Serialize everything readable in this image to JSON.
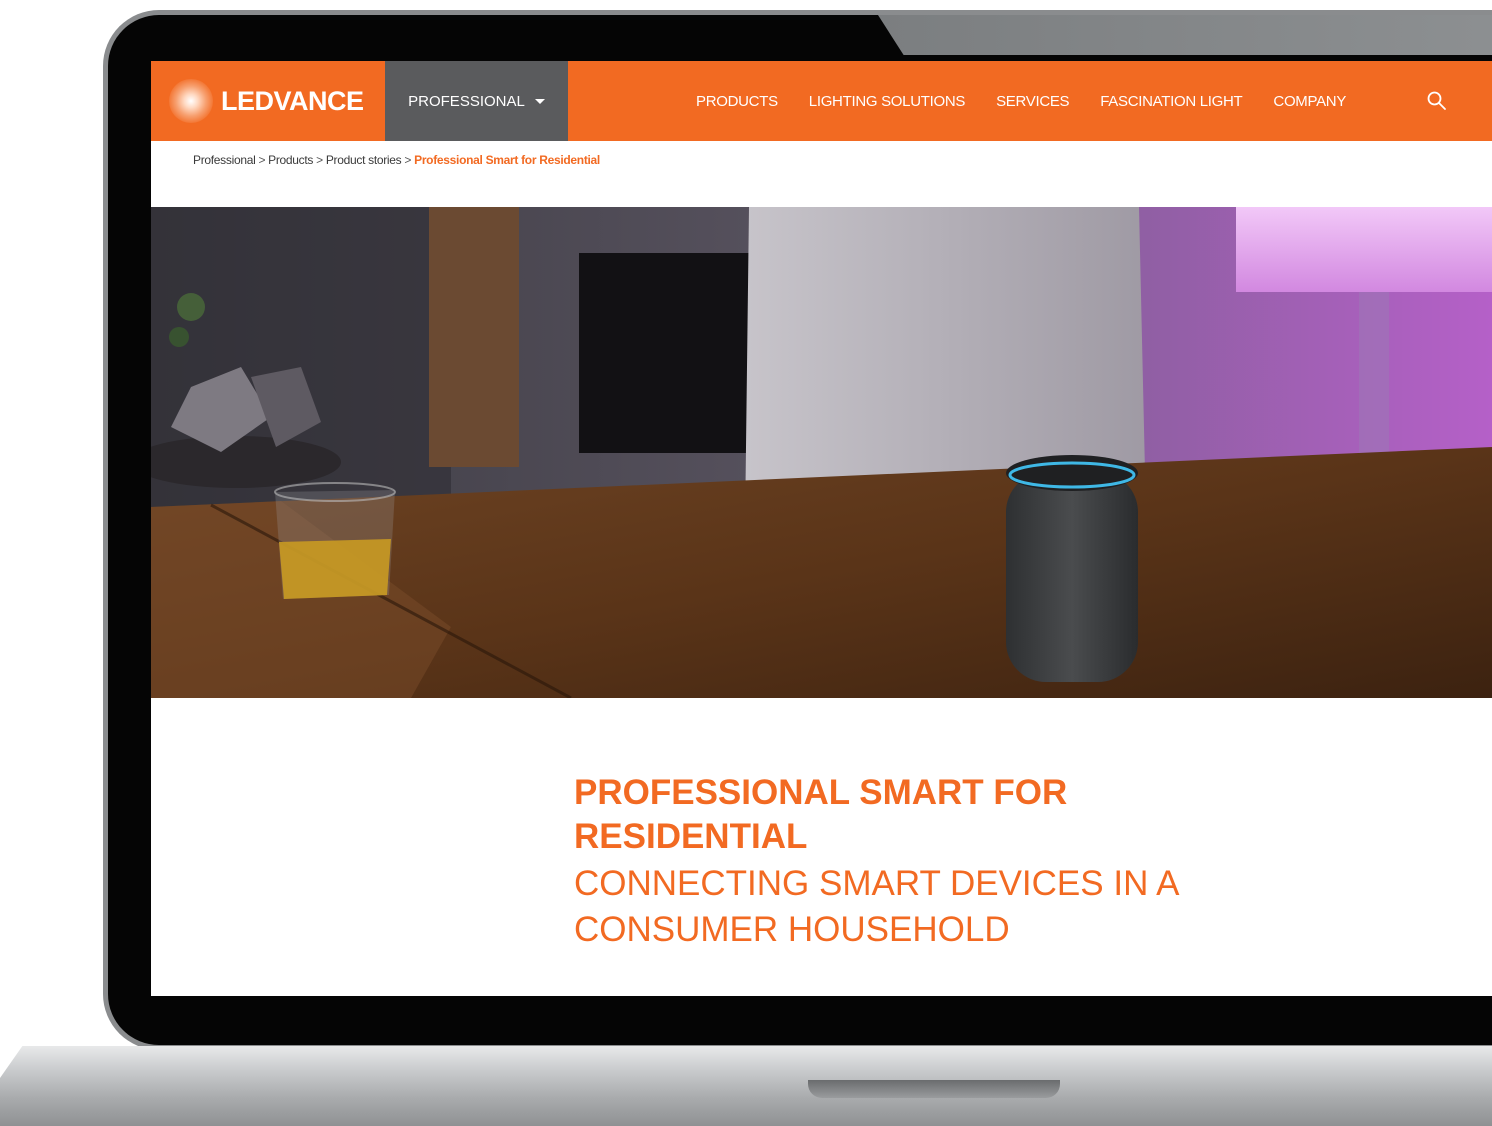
{
  "header": {
    "brand": "LEDVANCE",
    "professional_tab": "PROFESSIONAL",
    "nav": [
      "PRODUCTS",
      "LIGHTING SOLUTIONS",
      "SERVICES",
      "FASCINATION LIGHT",
      "COMPANY"
    ]
  },
  "breadcrumb": {
    "items": [
      "Professional",
      "Products",
      "Product stories"
    ],
    "current": "Professional Smart for Residential",
    "separator": ">"
  },
  "headline": {
    "title": "PROFESSIONAL SMART FOR RESIDENTIAL",
    "subtitle": "CONNECTING SMART DEVICES IN A CONSUMER HOUSEHOLD"
  },
  "colors": {
    "accent": "#f26a22",
    "tab": "#5a5b5d",
    "speaker_ring": "#3fb8e6"
  },
  "icons": {
    "search": "search-icon",
    "dropdown": "chevron-down-icon"
  }
}
